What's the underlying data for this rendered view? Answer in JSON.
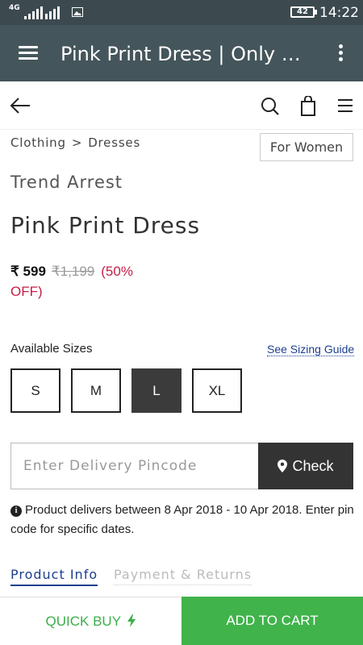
{
  "status_bar": {
    "network": "4G",
    "battery": "42",
    "time": "14:22"
  },
  "app_bar": {
    "title": "Pink Print Dress | Only on…"
  },
  "icons": {
    "menu": "hamburger-menu-icon",
    "overflow": "more-vertical-icon",
    "back": "arrow-left-icon",
    "search": "search-icon",
    "bag": "shopping-bag-icon",
    "nav_menu": "menu-icon",
    "location": "map-pin-icon",
    "bolt": "lightning-icon",
    "info": "info-icon"
  },
  "breadcrumb": {
    "level1": "Clothing",
    "separator": ">",
    "level2": "Dresses"
  },
  "category_tag": "For Women",
  "product": {
    "brand": "Trend Arrest",
    "title": "Pink Print Dress",
    "price": "₹ 599",
    "mrp": "₹1,199",
    "discount": "(50% OFF)"
  },
  "sizes": {
    "label": "Available Sizes",
    "guide_link": "See Sizing Guide",
    "options": [
      "S",
      "M",
      "L",
      "XL"
    ],
    "selected": "L"
  },
  "pincode": {
    "placeholder": "Enter Delivery Pincode",
    "button": "Check"
  },
  "delivery_note": "Product delivers between 8 Apr 2018 - 10 Apr 2018. Enter pin code for specific dates.",
  "tabs": {
    "active": "Product Info",
    "inactive": "Payment & Returns"
  },
  "actions": {
    "quick_buy": "QUICK BUY",
    "add_to_cart": "ADD TO CART"
  },
  "colors": {
    "app_bar": "#44555b",
    "status_bar": "#3c4a50",
    "discount": "#c41e46",
    "link": "#1c3f8f",
    "accent_green": "#40b34b",
    "selected_size": "#3b3b3b"
  }
}
